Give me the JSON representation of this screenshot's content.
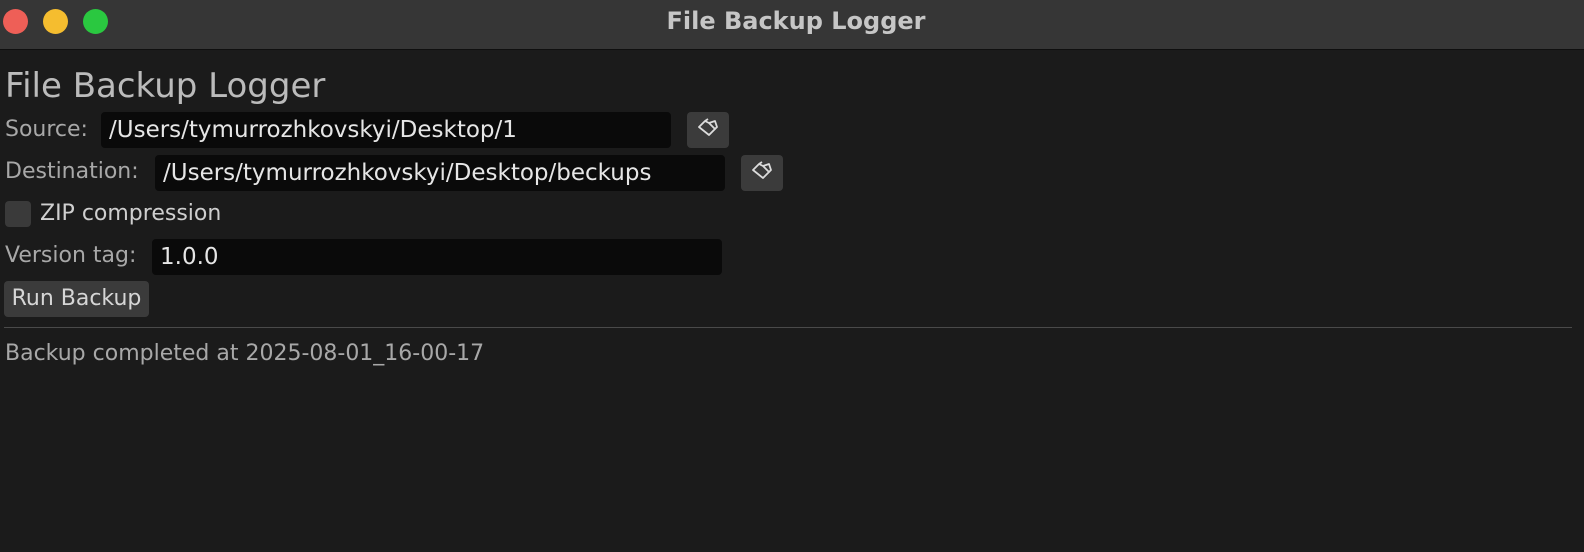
{
  "window": {
    "title": "File Backup Logger",
    "controls": {
      "close_color": "#ee5f57",
      "minimize_color": "#f5bd2f",
      "zoom_color": "#2ac840"
    }
  },
  "app": {
    "heading": "File Backup Logger"
  },
  "source": {
    "label": "Source:",
    "value": "/Users/tymurrozhkovskyi/Desktop/1",
    "browse_icon": "folder-icon"
  },
  "destination": {
    "label": "Destination:",
    "value": "/Users/tymurrozhkovskyi/Desktop/beckups",
    "browse_icon": "folder-icon"
  },
  "zip": {
    "label": "ZIP compression",
    "checked": false
  },
  "version": {
    "label": "Version tag:",
    "value": "1.0.0"
  },
  "actions": {
    "run_label": "Run Backup"
  },
  "status": {
    "text": "Backup completed at 2025-08-01_16-00-17"
  }
}
